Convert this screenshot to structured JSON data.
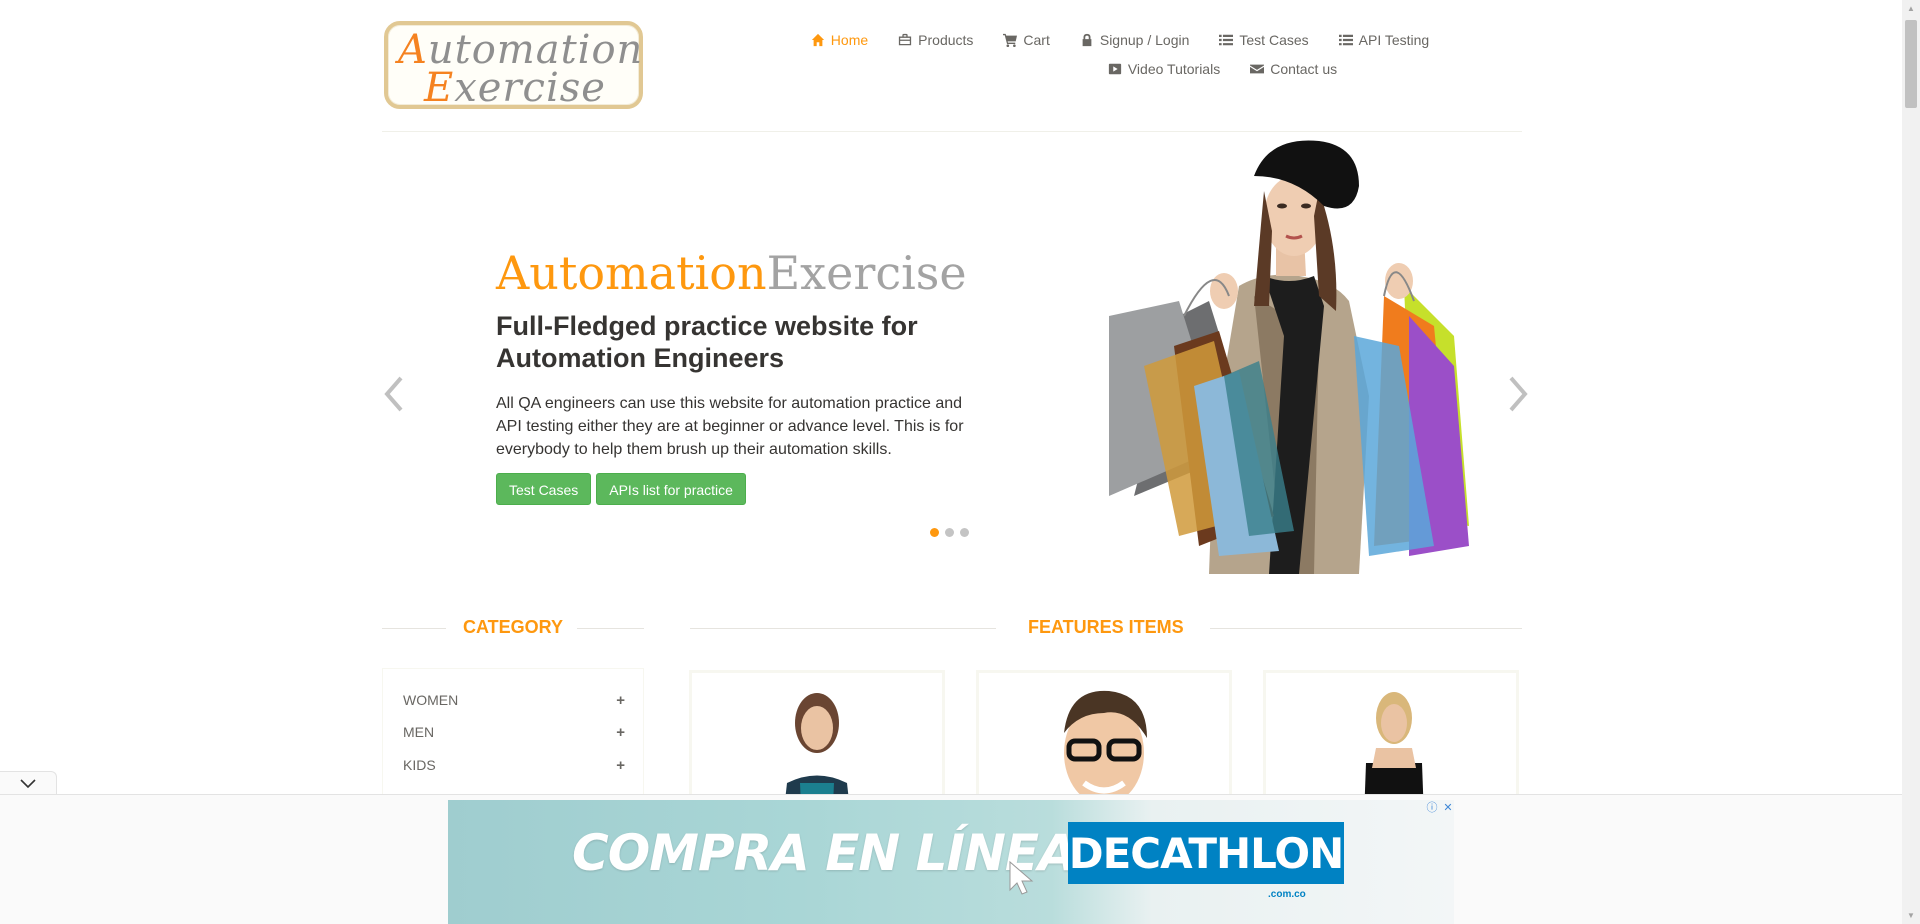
{
  "header": {
    "logo_line1": "Automation",
    "logo_line2": "Exercise",
    "nav_row1": [
      {
        "label": "Home",
        "icon": "home-icon"
      },
      {
        "label": "Products",
        "icon": "shopping-bag-icon"
      },
      {
        "label": "Cart",
        "icon": "cart-icon"
      },
      {
        "label": "Signup / Login",
        "icon": "lock-icon"
      },
      {
        "label": "Test Cases",
        "icon": "list-icon"
      },
      {
        "label": "API Testing",
        "icon": "list-icon"
      }
    ],
    "nav_row2": [
      {
        "label": "Video Tutorials",
        "icon": "youtube-play-icon"
      },
      {
        "label": "Contact us",
        "icon": "envelope-icon"
      }
    ],
    "active_color": "#fe980f"
  },
  "slider": {
    "title_part1": "Automation",
    "title_part2": "Exercise",
    "subtitle": "Full-Fledged practice website for Automation Engineers",
    "description": "All QA engineers can use this website for automation practice and API testing either they are at beginner or advance level. This is for everybody to help them brush up their automation skills.",
    "btn_test_cases": "Test Cases",
    "btn_apis": "APIs list for practice",
    "dot_count": 3,
    "active_dot": 1
  },
  "sections": {
    "category_heading": "CATEGORY",
    "features_heading": "FEATURES ITEMS"
  },
  "categories": [
    "WOMEN",
    "MEN",
    "KIDS"
  ],
  "ad": {
    "headline": "COMPRA EN LÍNEA",
    "brand": "DECATHLON",
    "domain": ".com.co"
  },
  "colors": {
    "accent": "#fe980f",
    "button_green": "#5cb85c",
    "brand_blue": "#0082c3"
  }
}
